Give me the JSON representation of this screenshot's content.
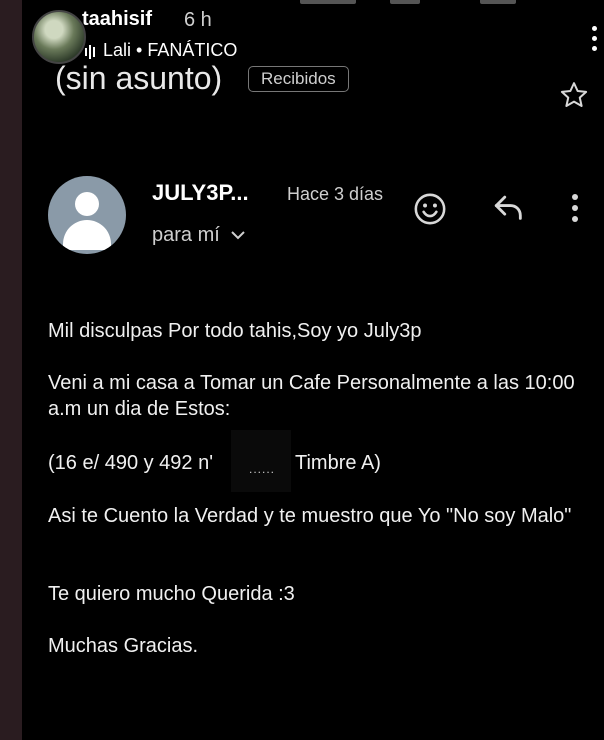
{
  "story": {
    "username": "taahisif",
    "time": "6 h",
    "music": "Lali • FANÁTICO"
  },
  "email": {
    "subject": "(sin asunto)",
    "label": "Recibidos",
    "sender": "JULY3P...",
    "time": "Hace 3 días",
    "recipient": "para mí",
    "icons": {
      "star": "star-icon",
      "emoji": "emoji-icon",
      "reply": "reply-icon",
      "more": "more-vert-icon",
      "avatar": "person-icon"
    },
    "body": {
      "p1": "Mil disculpas Por todo tahis,Soy yo July3p",
      "p2": "Veni a mi casa a Tomar un Cafe Personalmente a las 10:00 a.m un dia de Estos:",
      "p3a": "(16 e/ 490 y 492 n'",
      "redacted": "......",
      "p3b": "Timbre A)",
      "p4": "Asi te Cuento la Verdad y te muestro que Yo \"No soy Malo\"",
      "p5": "Te quiero mucho Querida :3",
      "p6": "Muchas Gracias."
    }
  },
  "colors": {
    "background": "#000000",
    "text": "#f0f0f0",
    "avatar": "#8a9aa8"
  }
}
